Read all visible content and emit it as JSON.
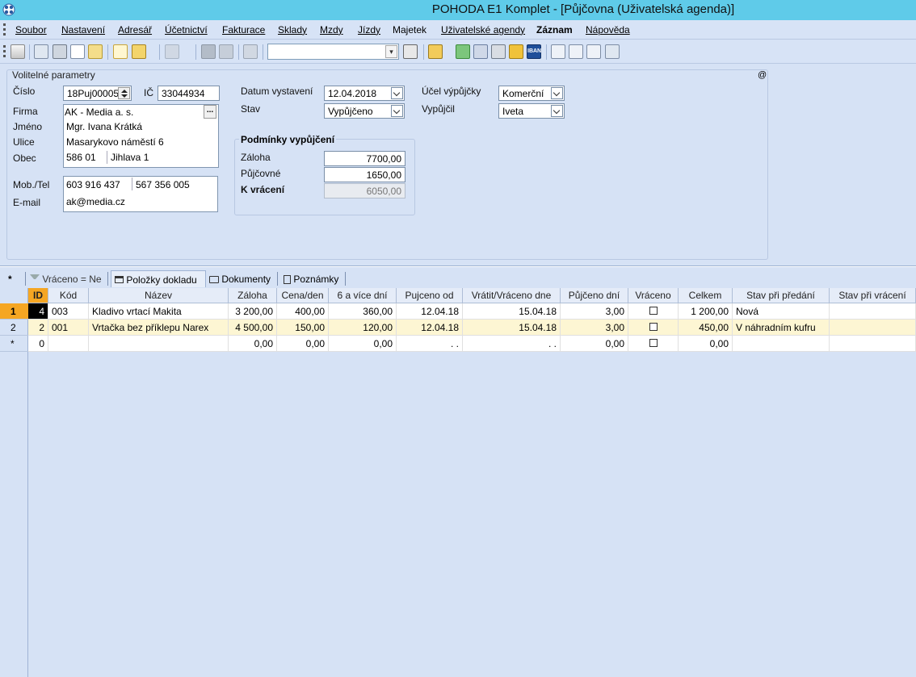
{
  "window": {
    "title": "POHODA E1 Komplet - [Půjčovna (Uživatelská agenda)]"
  },
  "menu": [
    "Soubor",
    "Nastavení",
    "Adresář",
    "Účetnictví",
    "Fakturace",
    "Sklady",
    "Mzdy",
    "Jízdy",
    "Majetek",
    "Uživatelské agendy",
    "Záznam",
    "Nápověda"
  ],
  "toolbar": {
    "search_value": ""
  },
  "form": {
    "section_title": "Volitelné parametry",
    "at_sign": "@",
    "cislo_label": "Číslo",
    "cislo_value": "18Puj00005",
    "ic_label": "IČ",
    "ic_value": "33044934",
    "firma_label": "Firma",
    "firma_value": "AK - Media a. s.",
    "jmeno_label": "Jméno",
    "jmeno_value": "Mgr. Ivana Krátká",
    "ulice_label": "Ulice",
    "ulice_value": "Masarykovo náměstí 6",
    "obec_label": "Obec",
    "psc_value": "586 01",
    "obec_value": "Jihlava 1",
    "mobtel_label": "Mob./Tel",
    "mob_value": "603 916 437",
    "tel_value": "567 356 005",
    "email_label": "E-mail",
    "email_value": "ak@media.cz",
    "datum_label": "Datum vystavení",
    "datum_value": "12.04.2018",
    "stav_label": "Stav",
    "stav_value": "Vypůjčeno",
    "ucel_label": "Účel výpůjčky",
    "ucel_value": "Komerční",
    "vypujcil_label": "Vypůjčil",
    "vypujcil_value": "Iveta",
    "podminky_title": "Podmínky vypůjčení",
    "zaloha_label": "Záloha",
    "zaloha_value": "7700,00",
    "pujcovne_label": "Půjčovné",
    "pujcovne_value": "1650,00",
    "kvraceni_label": "K vrácení",
    "kvraceni_value": "6050,00"
  },
  "tabs": {
    "star": "*",
    "filter": "Vráceno = Ne",
    "items": "Položky dokladu",
    "documents": "Dokumenty",
    "notes": "Poznámky"
  },
  "grid": {
    "columns": [
      "ID",
      "Kód",
      "Název",
      "Záloha",
      "Cena/den",
      "6 a více dní",
      "Pujceno od",
      "Vrátit/Vráceno dne",
      "Půjčeno dní",
      "Vráceno",
      "Celkem",
      "Stav při předání",
      "Stav při vrácení"
    ],
    "rows": [
      {
        "rowhdr": "1",
        "id": "4",
        "kod": "003",
        "nazev": "Kladivo vrtací Makita",
        "zaloha": "3 200,00",
        "cena": "400,00",
        "sest": "360,00",
        "od": "12.04.18",
        "vratit": "15.04.18",
        "dni": "3,00",
        "celkem": "1 200,00",
        "predani": "Nová",
        "vraceni": ""
      },
      {
        "rowhdr": "2",
        "id": "2",
        "kod": "001",
        "nazev": "Vrtačka bez příklepu Narex",
        "zaloha": "4 500,00",
        "cena": "150,00",
        "sest": "120,00",
        "od": "12.04.18",
        "vratit": "15.04.18",
        "dni": "3,00",
        "celkem": "450,00",
        "predani": "V náhradním kufru",
        "vraceni": ""
      },
      {
        "rowhdr": "*",
        "id": "0",
        "kod": "",
        "nazev": "",
        "zaloha": "0,00",
        "cena": "0,00",
        "sest": "0,00",
        "od": ". .",
        "vratit": ". .",
        "dni": "0,00",
        "celkem": "0,00",
        "predani": "",
        "vraceni": ""
      }
    ]
  }
}
